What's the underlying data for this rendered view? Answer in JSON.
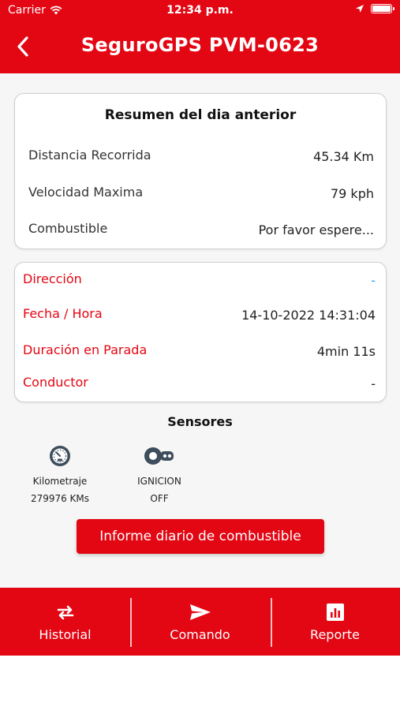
{
  "status_bar": {
    "carrier": "Carrier",
    "time": "12:34 p.m."
  },
  "header": {
    "title": "SeguroGPS PVM-0623",
    "background_color": "#e30613"
  },
  "summary_card": {
    "title": "Resumen del dia anterior",
    "rows": [
      {
        "label": "Distancia Recorrida",
        "value": "45.34 Km"
      },
      {
        "label": "Velocidad Maxima",
        "value": "79 kph"
      },
      {
        "label": "Combustible",
        "value": "Por favor espere..."
      }
    ]
  },
  "detail_card": {
    "rows": [
      {
        "label": "Dirección",
        "value": "-"
      },
      {
        "label": "Fecha / Hora",
        "value": "14-10-2022 14:31:04"
      },
      {
        "label": "Duración en Parada",
        "value": "4min 11s"
      },
      {
        "label": "Conductor",
        "value": "-"
      }
    ]
  },
  "sensors": {
    "title": "Sensores",
    "items": [
      {
        "name": "Kilometraje",
        "value": "279976 KMs",
        "icon": "odometer-icon"
      },
      {
        "name": "IGNICION",
        "value": "OFF",
        "icon": "ignition-key-icon"
      }
    ]
  },
  "fuel_report_button": "Informe diario de combustible",
  "bottom_nav": [
    {
      "label": "Historial",
      "icon": "repeat-arrows-icon"
    },
    {
      "label": "Comando",
      "icon": "send-icon"
    },
    {
      "label": "Reporte",
      "icon": "bar-chart-icon"
    }
  ]
}
